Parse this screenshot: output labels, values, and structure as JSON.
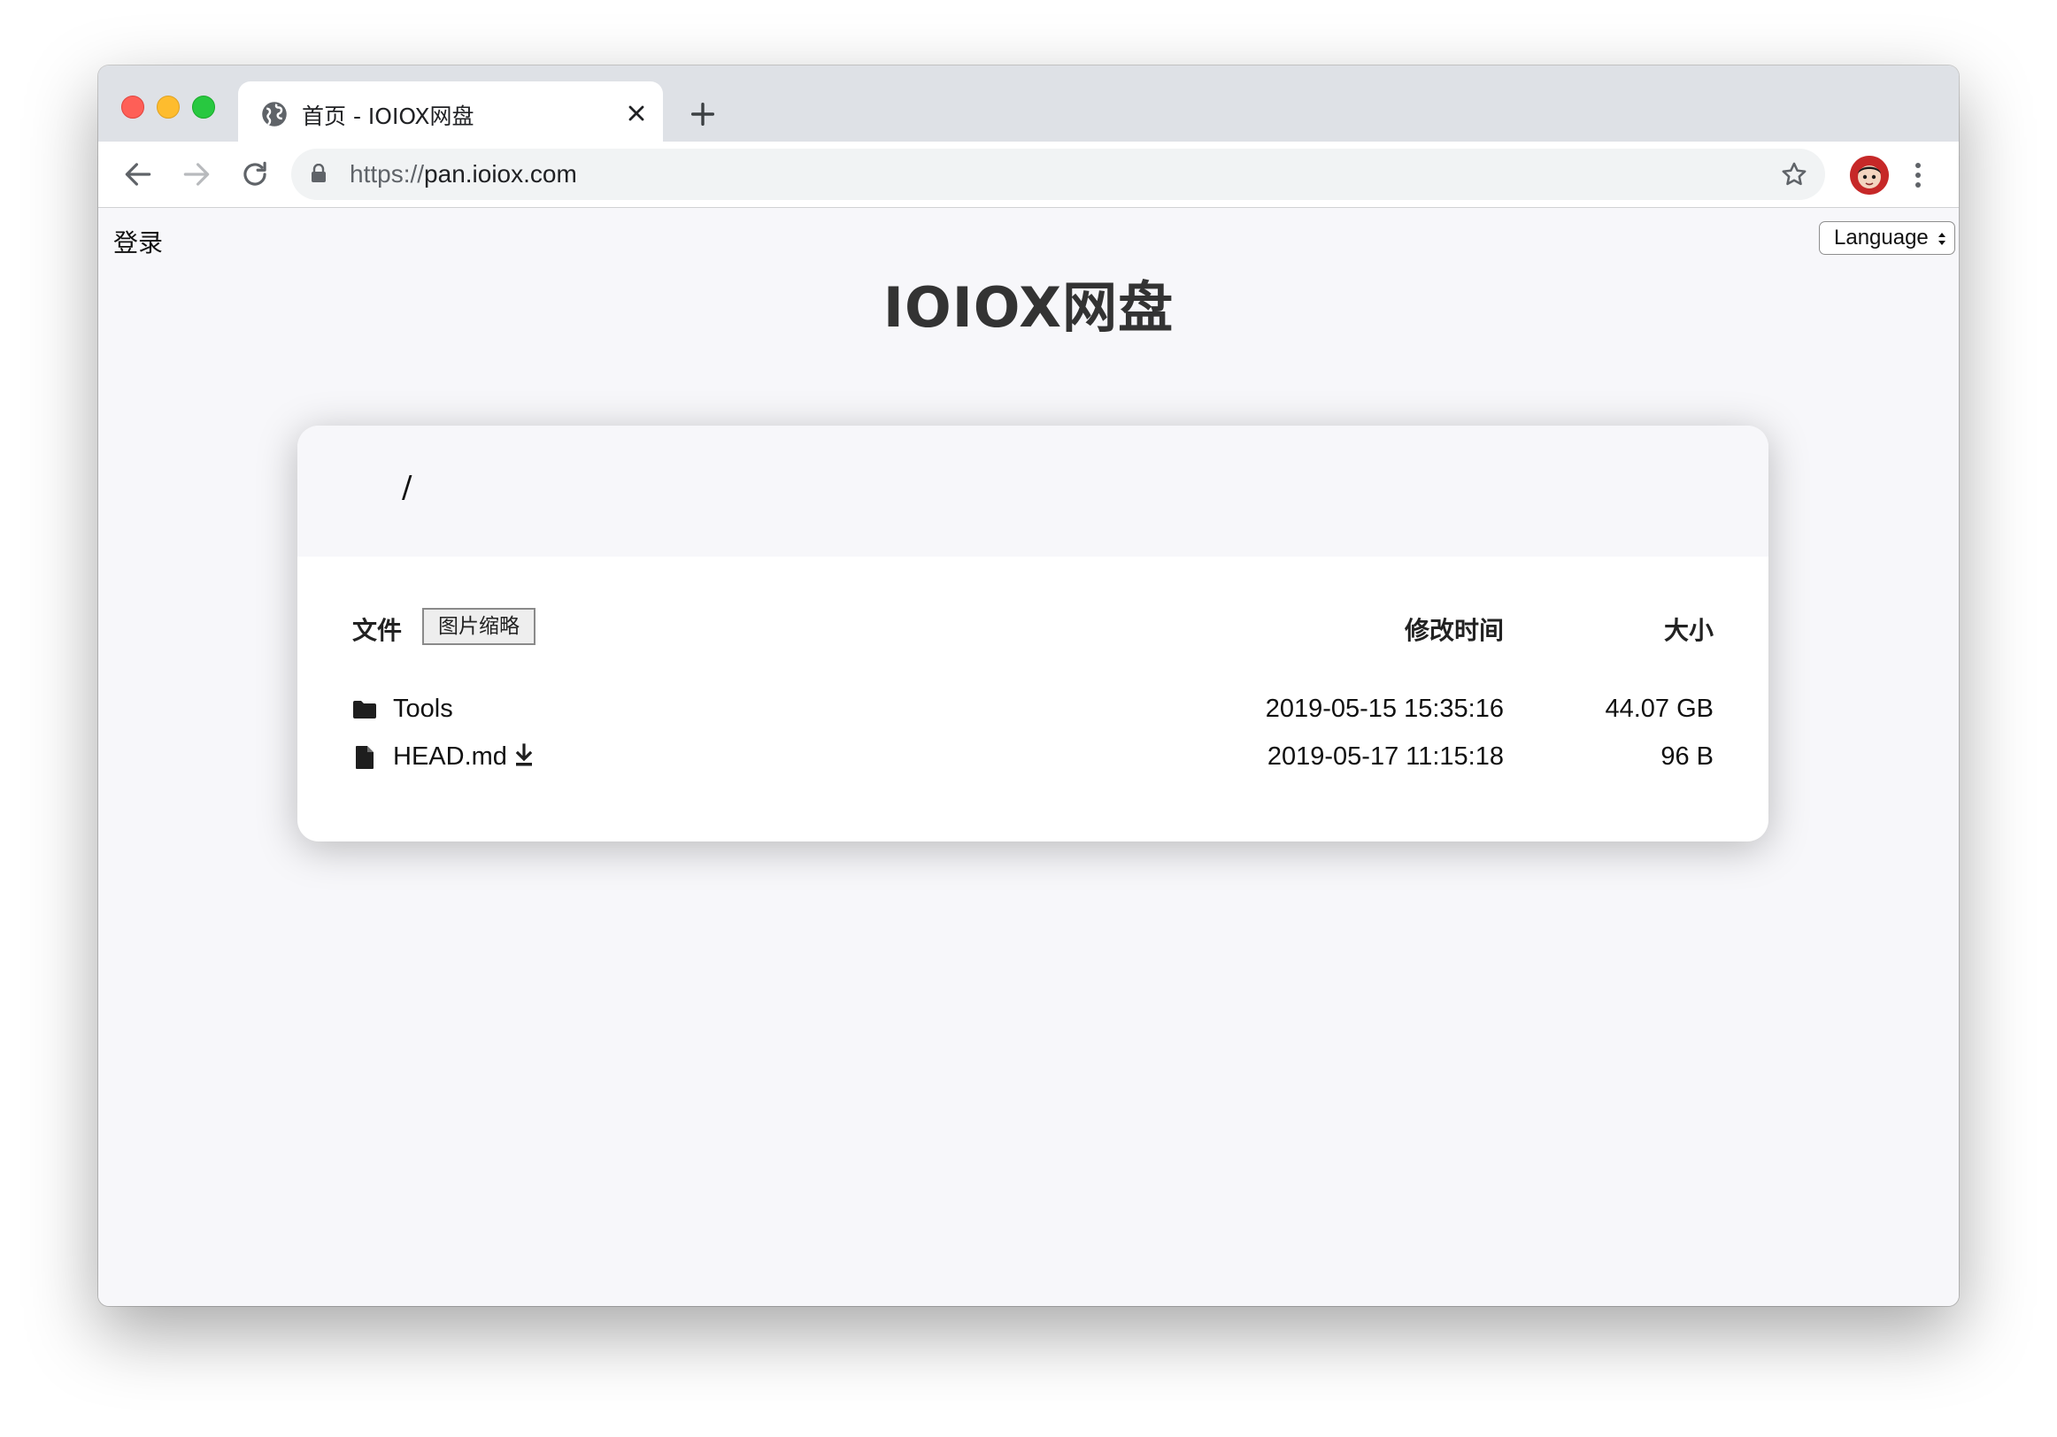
{
  "browser": {
    "tab_title": "首页 - IOIOX网盘",
    "url_scheme": "https://",
    "url_host": "pan.ioiox.com"
  },
  "page": {
    "login_label": "登录",
    "language_label": "Language",
    "site_title": "IOIOX网盘"
  },
  "listing": {
    "breadcrumb": "/",
    "col_file": "文件",
    "thumbnail_button": "图片缩略",
    "col_modified": "修改时间",
    "col_size": "大小",
    "rows": [
      {
        "type": "folder",
        "name": "Tools",
        "modified": "2019-05-15 15:35:16",
        "size": "44.07 GB"
      },
      {
        "type": "file",
        "name": "HEAD.md",
        "modified": "2019-05-17 11:15:18",
        "size": "96 B"
      }
    ]
  },
  "colors": {
    "accent_red": "#fe5f57",
    "accent_yellow": "#febc2e",
    "accent_green": "#28c840",
    "page_bg": "#f7f7fa"
  }
}
